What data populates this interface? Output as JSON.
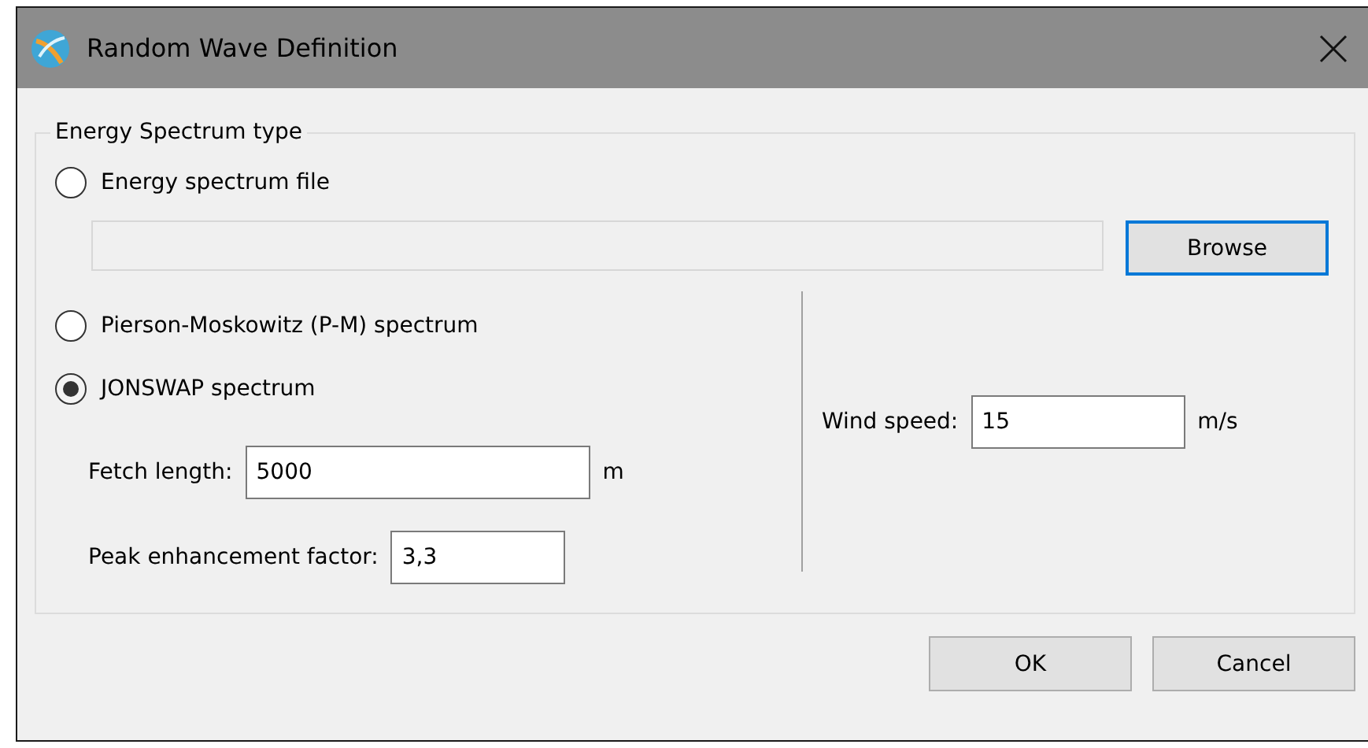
{
  "window": {
    "title": "Random Wave Definition"
  },
  "group": {
    "title": "Energy Spectrum type"
  },
  "spectrum_types": [
    {
      "label": "Energy spectrum file",
      "selected": false
    },
    {
      "label": "Pierson-Moskowitz (P-M) spectrum",
      "selected": false
    },
    {
      "label": "JONSWAP spectrum",
      "selected": true
    }
  ],
  "file_field": {
    "disabled": true
  },
  "browse_button": "Browse",
  "fetch_length": {
    "label": "Fetch length:",
    "value": "5000",
    "unit": "m"
  },
  "peak_enhancement": {
    "label": "Peak enhancement factor:",
    "value": "3,3"
  },
  "wind_speed": {
    "label": "Wind speed:",
    "value": "15",
    "unit": "m/s"
  },
  "buttons": [
    "OK",
    "Cancel"
  ]
}
